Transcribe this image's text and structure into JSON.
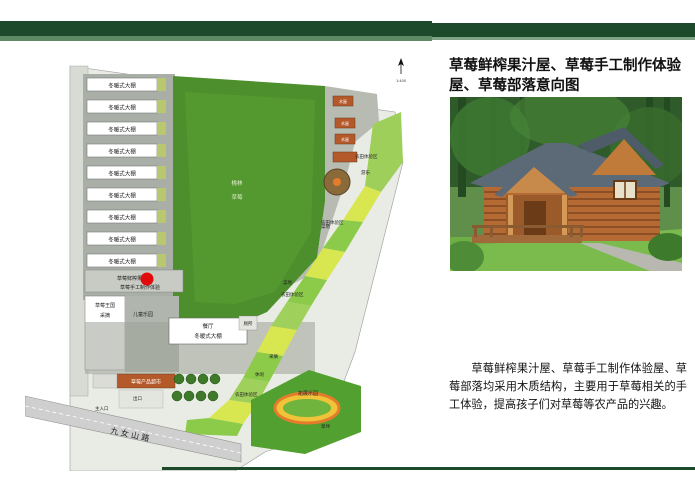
{
  "title": "草莓鲜榨果汁屋、草莓手工制作体验屋、草莓部落意向图",
  "description": "草莓鲜榨果汁屋、草莓手工制作体验屋、草莓部落均采用木质结构，主要用于草莓相关的手工体验，提高孩子们对草莓等农产品的兴趣。",
  "plan": {
    "greenhouse_label": "冬暖式大棚",
    "greenhouse_count": 9,
    "center_label_1": "桃林",
    "center_label_2": "草莓",
    "juice_label_1": "草莓鲜榨果汁屋",
    "juice_label_2": "草莓手工制作体验",
    "kingdom_label_1": "草莓王国",
    "kingdom_label_2": "采摘",
    "kingdom_paradise": "儿童乐园",
    "restaurant_1": "餐厅",
    "restaurant_2": "冬暖式大棚",
    "small_label": "厕所",
    "shop_label": "草莓产品超市",
    "exit_label": "出口",
    "entrance_label": "主入口",
    "road_label": "九 女 山 路",
    "experience_areas": [
      "农田体验区",
      "农田体验区",
      "农田体验区",
      "农田体验区"
    ],
    "sports_label": "拓展乐园",
    "misc_labels": [
      "游乐",
      "菜地",
      "菜地",
      "采摘",
      "休闲",
      "草坪"
    ],
    "hut_label": "木屋",
    "north_label": "1:400"
  }
}
